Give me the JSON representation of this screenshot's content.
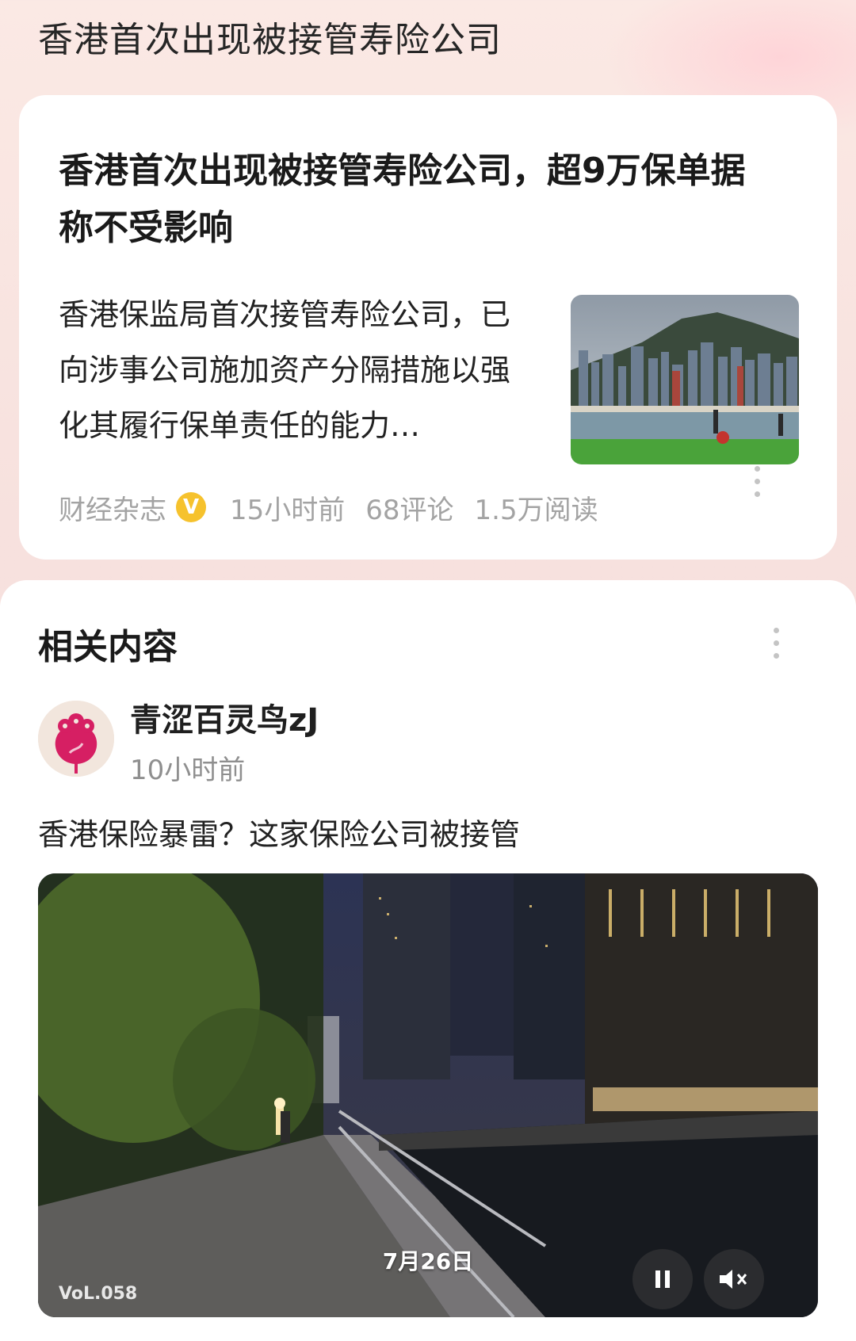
{
  "page": {
    "title": "香港首次出现被接管寿险公司"
  },
  "news_card": {
    "headline": "香港首次出现被接管寿险公司，超9万保单据称不受影响",
    "summary": "香港保监局首次接管寿险公司，已向涉事公司施加资产分隔措施以强化其履行保单责任的能力…",
    "source": "财经杂志",
    "verified_badge": "V",
    "time": "15小时前",
    "comments": "68评论",
    "reads": "1.5万阅读",
    "thumbnail_icon": "hong-kong-skyline-photo"
  },
  "related": {
    "section_title": "相关内容",
    "author": "青涩百灵鸟zJ",
    "time": "10小时前",
    "post_title": "香港保险暴雷？这家保险公司被接管",
    "video": {
      "date_overlay": "7月26日",
      "volume_tag": "VoL.058",
      "pause_icon": "pause-icon",
      "mute_icon": "mute-icon"
    }
  },
  "colors": {
    "background": "#f7e1de",
    "card": "#ffffff",
    "meta_text": "#a3a3a3",
    "badge": "#f6c22d",
    "avatar_accent": "#d61f63"
  }
}
